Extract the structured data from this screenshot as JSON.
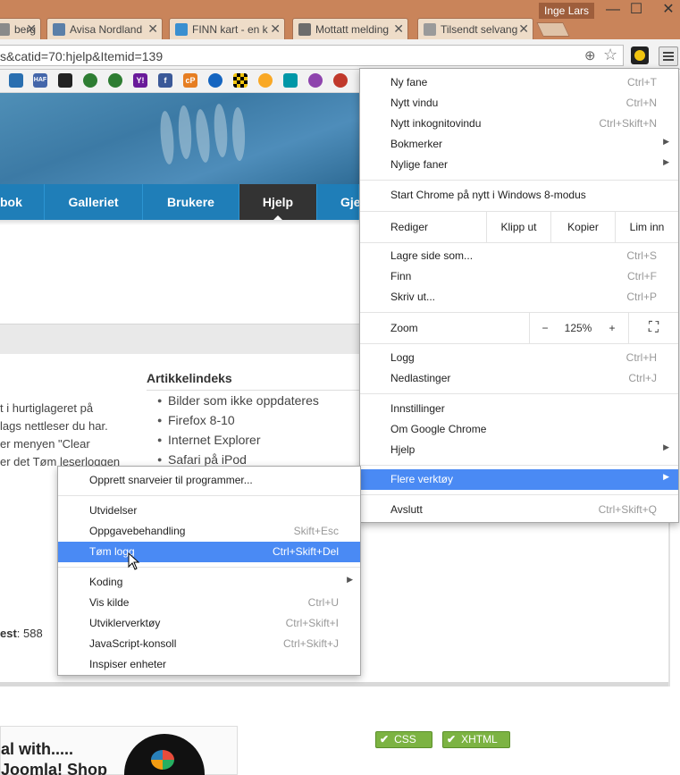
{
  "window": {
    "user": "Inge Lars",
    "controls": {
      "minimize": "—",
      "maximize": "☐",
      "close": "✕"
    }
  },
  "tabs": [
    {
      "title": "berg",
      "favicon": "page-icon",
      "color": "#8a8a8a",
      "close": "✕"
    },
    {
      "title": "Avisa Nordland",
      "favicon": "cube-icon",
      "color": "#5b7fa8",
      "close": "✕"
    },
    {
      "title": "FINN kart - en k",
      "favicon": "map-icon",
      "color": "#3a8fd0",
      "close": "✕"
    },
    {
      "title": "Mottatt melding",
      "favicon": "window-icon",
      "color": "#6c6c6c",
      "close": "✕"
    },
    {
      "title": "Tilsendt selvang",
      "favicon": "document-icon",
      "color": "#9a9a9a",
      "close": "✕"
    }
  ],
  "address_bar": {
    "url": "s&catid=70:hjelp&Itemid=139",
    "zoom_icon": "⊕",
    "star_icon": "☆"
  },
  "bookmarks": [
    {
      "icon": "puzzle-icon",
      "text": "",
      "color": "#2a6fb0"
    },
    {
      "icon": "haf-icon",
      "text": "HAF",
      "color": "#4466aa"
    },
    {
      "icon": "joomla-icon",
      "text": "",
      "color": "#222"
    },
    {
      "icon": "chat-icon",
      "text": "",
      "color": "#2e7d32"
    },
    {
      "icon": "chat-icon",
      "text": "",
      "color": "#2e7d32"
    },
    {
      "icon": "yahoo-icon",
      "text": "Y!",
      "color": "#6a1b9a"
    },
    {
      "icon": "facebook-icon",
      "text": "f",
      "color": "#3b5998"
    },
    {
      "icon": "cpanel-icon",
      "text": "cP",
      "color": "#e67e22"
    },
    {
      "icon": "globe-icon",
      "text": "",
      "color": "#1565c0"
    },
    {
      "icon": "checker-icon",
      "text": "",
      "color": "#f1c40f"
    },
    {
      "icon": "bulb-icon",
      "text": "",
      "color": "#f9a825"
    },
    {
      "icon": "grid-icon",
      "text": "",
      "color": "#0097a7"
    },
    {
      "icon": "sun-icon",
      "text": "",
      "color": "#8e44ad"
    },
    {
      "icon": "flag-icon",
      "text": "",
      "color": "#c0392b"
    }
  ],
  "nav": {
    "items": [
      "bok",
      "Galleriet",
      "Brukere",
      "Hjelp",
      "Gje"
    ],
    "active": "Hjelp"
  },
  "article_index": {
    "title": "Artikkelindeks",
    "items": [
      "Bilder som ikke oppdateres",
      "Firefox 8-10",
      "Internet Explorer",
      "Safari på iPod"
    ]
  },
  "body_lines": [
    "t i hurtiglageret på",
    "lags nettleser du har.",
    "er menyen \"Clear",
    "er det Tøm leserloggen"
  ],
  "stat": {
    "label": "est",
    "value": ": 588"
  },
  "badges": {
    "css": "CSS",
    "xhtml": "XHTML",
    "check": "✔"
  },
  "promo": {
    "line1": "al with.....",
    "line2": "Joomla! Shop"
  },
  "chrome_menu": {
    "group1": [
      {
        "label": "Ny fane",
        "shortcut": "Ctrl+T"
      },
      {
        "label": "Nytt vindu",
        "shortcut": "Ctrl+N"
      },
      {
        "label": "Nytt inkognitovindu",
        "shortcut": "Ctrl+Skift+N"
      },
      {
        "label": "Bokmerker",
        "shortcut": "",
        "arrow": "▶"
      },
      {
        "label": "Nylige faner",
        "shortcut": "",
        "arrow": "▶"
      }
    ],
    "win8": "Start Chrome på nytt i Windows 8-modus",
    "edit": {
      "label": "Rediger",
      "cut": "Klipp ut",
      "copy": "Kopier",
      "paste": "Lim inn"
    },
    "group3": [
      {
        "label": "Lagre side som...",
        "shortcut": "Ctrl+S"
      },
      {
        "label": "Finn",
        "shortcut": "Ctrl+F"
      },
      {
        "label": "Skriv ut...",
        "shortcut": "Ctrl+P"
      }
    ],
    "zoom": {
      "label": "Zoom",
      "minus": "−",
      "value": "125%",
      "plus": "+",
      "fullscreen": "⛶"
    },
    "group5": [
      {
        "label": "Logg",
        "shortcut": "Ctrl+H"
      },
      {
        "label": "Nedlastinger",
        "shortcut": "Ctrl+J"
      }
    ],
    "group6": [
      {
        "label": "Innstillinger",
        "shortcut": ""
      },
      {
        "label": "Om Google Chrome",
        "shortcut": ""
      },
      {
        "label": "Hjelp",
        "shortcut": "",
        "arrow": "▶"
      }
    ],
    "more_tools": {
      "label": "Flere verktøy",
      "arrow": "▶"
    },
    "exit": {
      "label": "Avslutt",
      "shortcut": "Ctrl+Skift+Q"
    }
  },
  "submenu": {
    "create_shortcuts": "Opprett snarveier til programmer...",
    "group2": [
      {
        "label": "Utvidelser",
        "shortcut": ""
      },
      {
        "label": "Oppgavebehandling",
        "shortcut": "Skift+Esc"
      },
      {
        "label": "Tøm logg",
        "shortcut": "Ctrl+Skift+Del"
      }
    ],
    "group3": [
      {
        "label": "Koding",
        "shortcut": "",
        "arrow": "▶"
      },
      {
        "label": "Vis kilde",
        "shortcut": "Ctrl+U"
      },
      {
        "label": "Utviklerverktøy",
        "shortcut": "Ctrl+Skift+I"
      },
      {
        "label": "JavaScript-konsoll",
        "shortcut": "Ctrl+Skift+J"
      },
      {
        "label": "Inspiser enheter",
        "shortcut": ""
      }
    ]
  },
  "colors": {
    "titlebar": "#c9845a",
    "nav": "#1f7eb8",
    "menu_highlight": "#4a8af4",
    "badge": "#7cb342"
  }
}
